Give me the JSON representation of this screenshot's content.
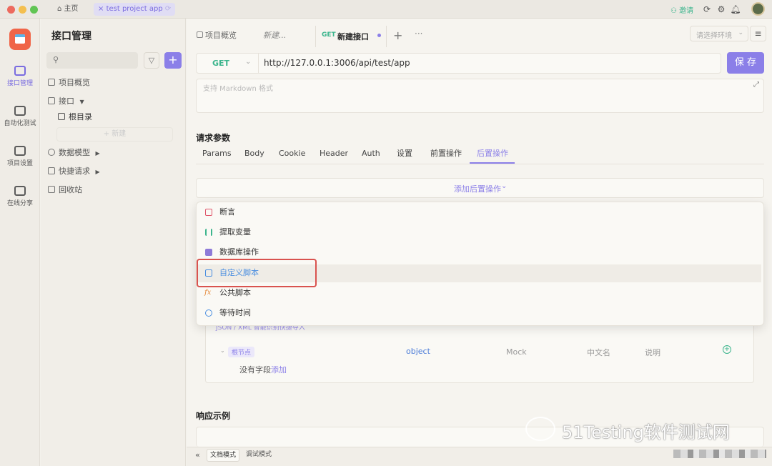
{
  "titlebar": {
    "home_tab": "主页",
    "project_tab": "test project app",
    "invite": "邀请"
  },
  "rail": {
    "items": [
      "接口管理",
      "自动化测试",
      "项目设置",
      "在线分享"
    ]
  },
  "tree": {
    "title": "接口管理",
    "search_placeholder": "",
    "add_label": "+",
    "items": {
      "overview": "项目概览",
      "interfaces": "接口",
      "root": "根目录",
      "new_btn": "+ 新建",
      "data_models": "数据模型",
      "quick_requests": "快捷请求",
      "trash": "回收站"
    }
  },
  "doc_tabs": {
    "overview": "项目概览",
    "new_dots": "新建...",
    "active_method": "GET",
    "active_label": "新建接口",
    "env_placeholder": "请选择环境"
  },
  "request": {
    "method": "GET",
    "url": "http://127.0.0.1:3006/api/test/app",
    "save": "保 存",
    "desc_placeholder": "支持 Markdown 格式"
  },
  "params": {
    "section_title": "请求参数",
    "tabs": [
      "Params",
      "Body",
      "Cookie",
      "Header",
      "Auth",
      "设置",
      "前置操作",
      "后置操作"
    ],
    "active_tab": "后置操作",
    "add_post": "添加后置操作"
  },
  "menu": {
    "items": [
      "断言",
      "提取变量",
      "数据库操作",
      "自定义脚本",
      "公共脚本",
      "等待时间"
    ],
    "colors": [
      "#e0566b",
      "#3cb58d",
      "#8e7bd8",
      "#4a8ee0",
      "#e58a3c",
      "#4a8ee0"
    ],
    "highlight_index": 3,
    "highlight_color": "#d9534f"
  },
  "schema": {
    "import_hint": "JSON / XML 智能识别快捷导入",
    "root_node": "根节点",
    "type": "object",
    "mock": "Mock",
    "cn_name": "中文名",
    "desc": "说明",
    "empty": "没有字段",
    "add_link": "添加"
  },
  "response": {
    "title": "响应示例"
  },
  "footer": {
    "doc_mode": "文档模式",
    "debug_mode": "调试模式"
  },
  "watermark": "51Testing软件测试网",
  "theme": {
    "accent": "#8b7fe8",
    "get_green": "#3cb58d"
  }
}
